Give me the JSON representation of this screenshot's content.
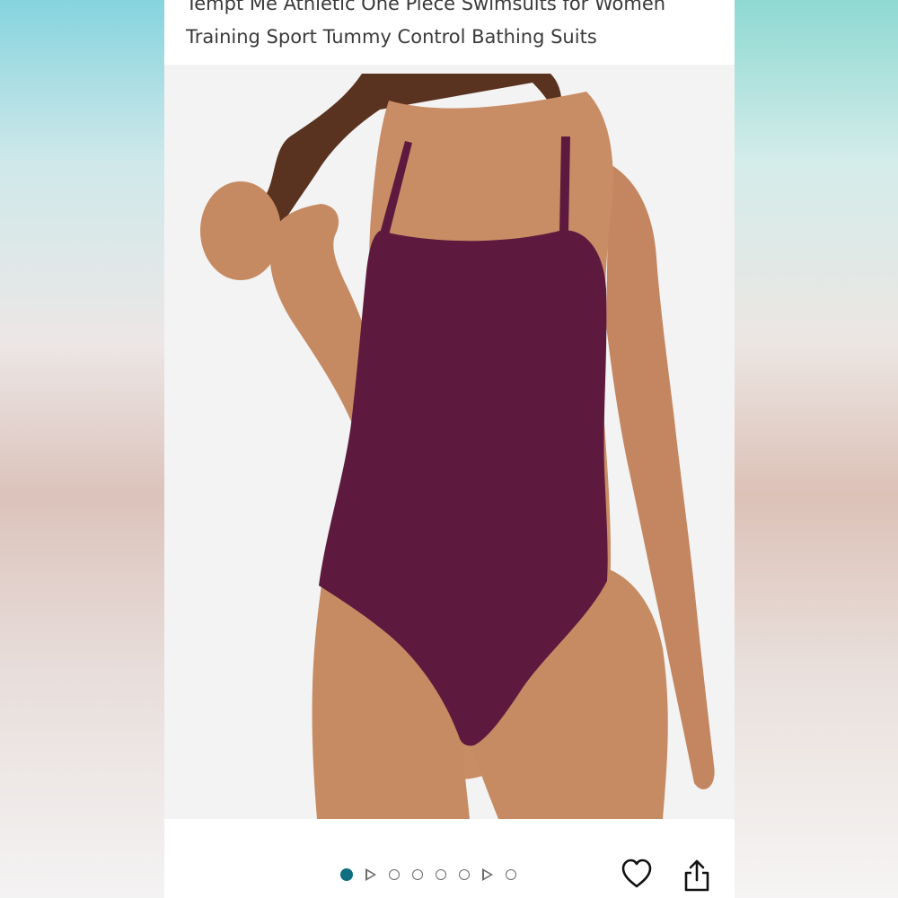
{
  "product": {
    "title": "Tempt Me Athletic One Piece Swimsuits for Women Training Sport Tummy Control Bathing Suits"
  },
  "gallery": {
    "indicators": [
      "dot-active",
      "video",
      "dot",
      "dot",
      "dot",
      "dot",
      "video",
      "dot"
    ],
    "active_index": 0
  },
  "actions": {
    "favorite_icon": "heart-icon",
    "share_icon": "share-icon"
  },
  "colors": {
    "swimsuit": "#5e1a3e",
    "active_dot": "#0f6e80"
  }
}
